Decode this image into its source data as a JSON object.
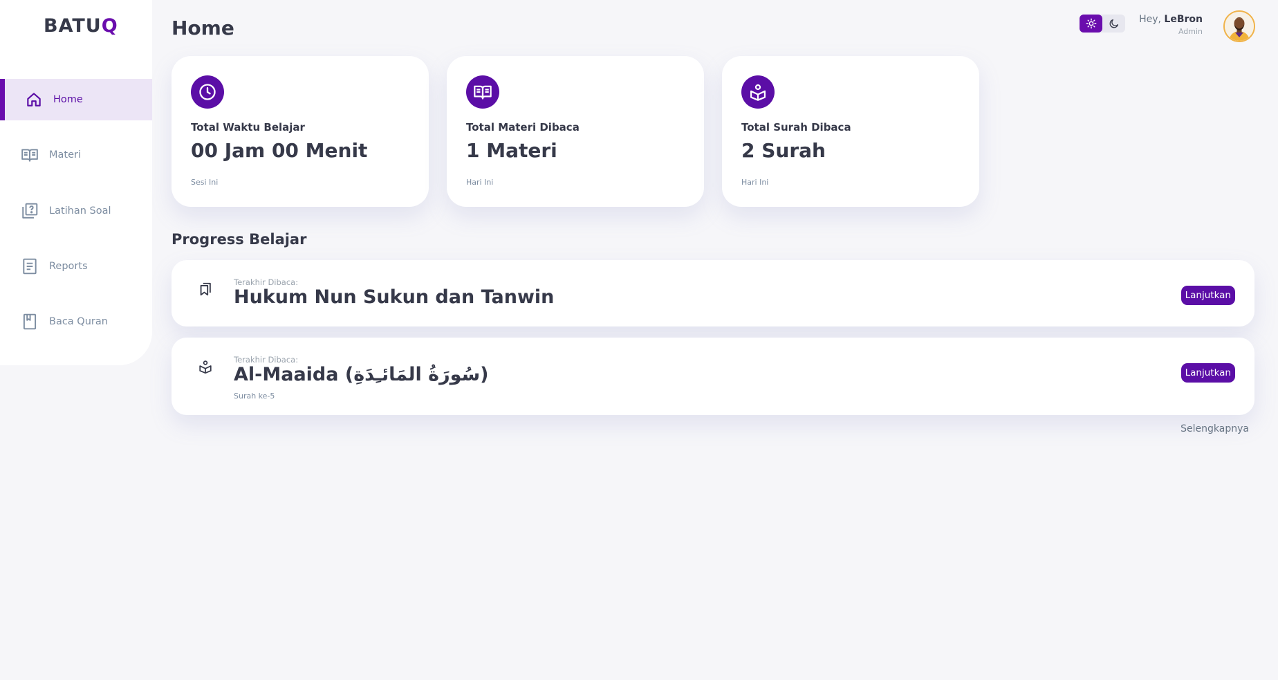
{
  "brand": {
    "name_start": "BATU",
    "name_end": "Q"
  },
  "sidebar": {
    "items": [
      {
        "label": "Home",
        "icon": "home-icon",
        "active": true
      },
      {
        "label": "Materi",
        "icon": "book-open-icon"
      },
      {
        "label": "Latihan Soal",
        "icon": "quiz-icon"
      },
      {
        "label": "Reports",
        "icon": "report-icon"
      },
      {
        "label": "Baca Quran",
        "icon": "quran-book-icon"
      }
    ]
  },
  "header": {
    "title": "Home",
    "greeting": "Hey,",
    "user_name": "LeBron",
    "user_role": "Admin"
  },
  "stats": [
    {
      "title": "Total Waktu Belajar",
      "value": "00 Jam 00 Menit",
      "note": "Sesi Ini",
      "icon": "clock-icon"
    },
    {
      "title": "Total Materi Dibaca",
      "value": "1 Materi",
      "note": "Hari Ini",
      "icon": "book-open-icon"
    },
    {
      "title": "Total Surah Dibaca",
      "value": "2 Surah",
      "note": "Hari Ini",
      "icon": "quran-reader-icon"
    }
  ],
  "progress": {
    "title": "Progress Belajar",
    "items": [
      {
        "label": "Terakhir Dibaca:",
        "title": "Hukum Nun Sukun dan Tanwin",
        "sub": "",
        "button": "Lanjutkan",
        "icon": "bookmark-icon"
      },
      {
        "label": "Terakhir Dibaca:",
        "title": "Al-Maaida (سُورَةُ المَائـِدَةِ)",
        "sub": "Surah ke-5",
        "button": "Lanjutkan",
        "icon": "quran-reader-icon"
      }
    ],
    "more": "Selengkapnya"
  },
  "colors": {
    "accent": "#5b0ea6",
    "background": "#f6f6f9",
    "text": "#363949",
    "muted": "#7d8da1"
  }
}
